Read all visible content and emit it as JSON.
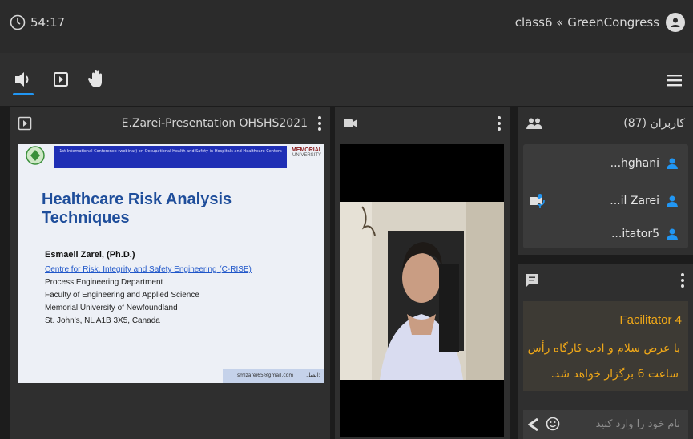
{
  "header": {
    "timer": "54:17",
    "room_title": "class6 « GreenCongress"
  },
  "presentation": {
    "title": "E.Zarei-Presentation OHSHS2021"
  },
  "slide": {
    "banner": "1st International Conference (webinar) on Occupational Health and Safety in Hospitals and Healthcare Centers",
    "logo_text_1": "MEMORIAL",
    "logo_text_2": "UNIVERSITY",
    "title": "Healthcare Risk Analysis Techniques",
    "author": "Esmaeil Zarei, (Ph.D.)",
    "lines": [
      "Centre for Risk, Integrity and Safety Engineering (C-RISE)",
      "Process Engineering Department",
      "Faculty of Engineering and Applied Science",
      "Memorial University of Newfoundland",
      "St. John's, NL A1B 3X5, Canada"
    ],
    "email": "smlzarei65@gmail.com",
    "email_label": "ایمیل:"
  },
  "users": {
    "header": "کاربران (87)",
    "items": [
      {
        "name": "...hghani"
      },
      {
        "name": "...il Zarei"
      },
      {
        "name": "...itator5"
      }
    ]
  },
  "chat": {
    "sender": "Facilitator 4",
    "message_line1": "با عرض سلام و ادب کارگاه رأس",
    "message_line2": "ساعت 6 برگزار خواهد شد.",
    "input_placeholder": "نام خود را وارد کنید"
  },
  "colors": {
    "accent": "#2196f3",
    "chat_text": "#f0a818",
    "slide_title": "#1f4e9b"
  }
}
